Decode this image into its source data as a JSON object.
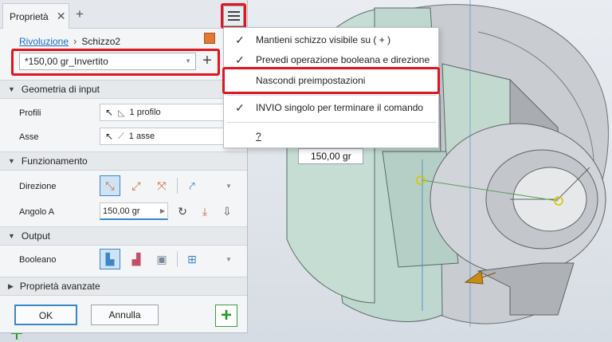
{
  "panel": {
    "tab_title": "Proprietà",
    "tab_close": "✕",
    "tab_add": "+",
    "breadcrumb": {
      "feature": "Rivoluzione",
      "separator": "›",
      "sketch": "Schizzo2"
    },
    "preset": {
      "value": "*150,00 gr_Invertito",
      "add": "+"
    },
    "sections": {
      "input": "Geometria di input",
      "operation": "Funzionamento",
      "output": "Output",
      "advanced": "Proprietà avanzate"
    },
    "input": {
      "profiles_label": "Profili",
      "profiles_value": "1 profilo",
      "axis_label": "Asse",
      "axis_value": "1 asse"
    },
    "operation": {
      "direction_label": "Direzione",
      "angle_label": "Angolo A",
      "angle_value": "150,00 gr"
    },
    "output": {
      "boolean_label": "Booleano"
    },
    "footer": {
      "ok": "OK",
      "cancel": "Annulla",
      "apply": "+"
    }
  },
  "popup": {
    "items": [
      {
        "label": "Mantieni schizzo visibile su ( + )",
        "checked": "✓"
      },
      {
        "label": "Prevedi operazione booleana e direzione",
        "checked": "✓"
      },
      {
        "label": "Nascondi preimpostazioni",
        "checked": ""
      },
      {
        "label": "INVIO singolo per terminare il comando",
        "checked": "✓"
      },
      {
        "label": "?",
        "checked": ""
      }
    ]
  },
  "viewport": {
    "dimension": "150,00 gr"
  },
  "colors": {
    "highlight": "#e0151e",
    "accent": "#3b86c7",
    "link": "#1a6fc2"
  }
}
